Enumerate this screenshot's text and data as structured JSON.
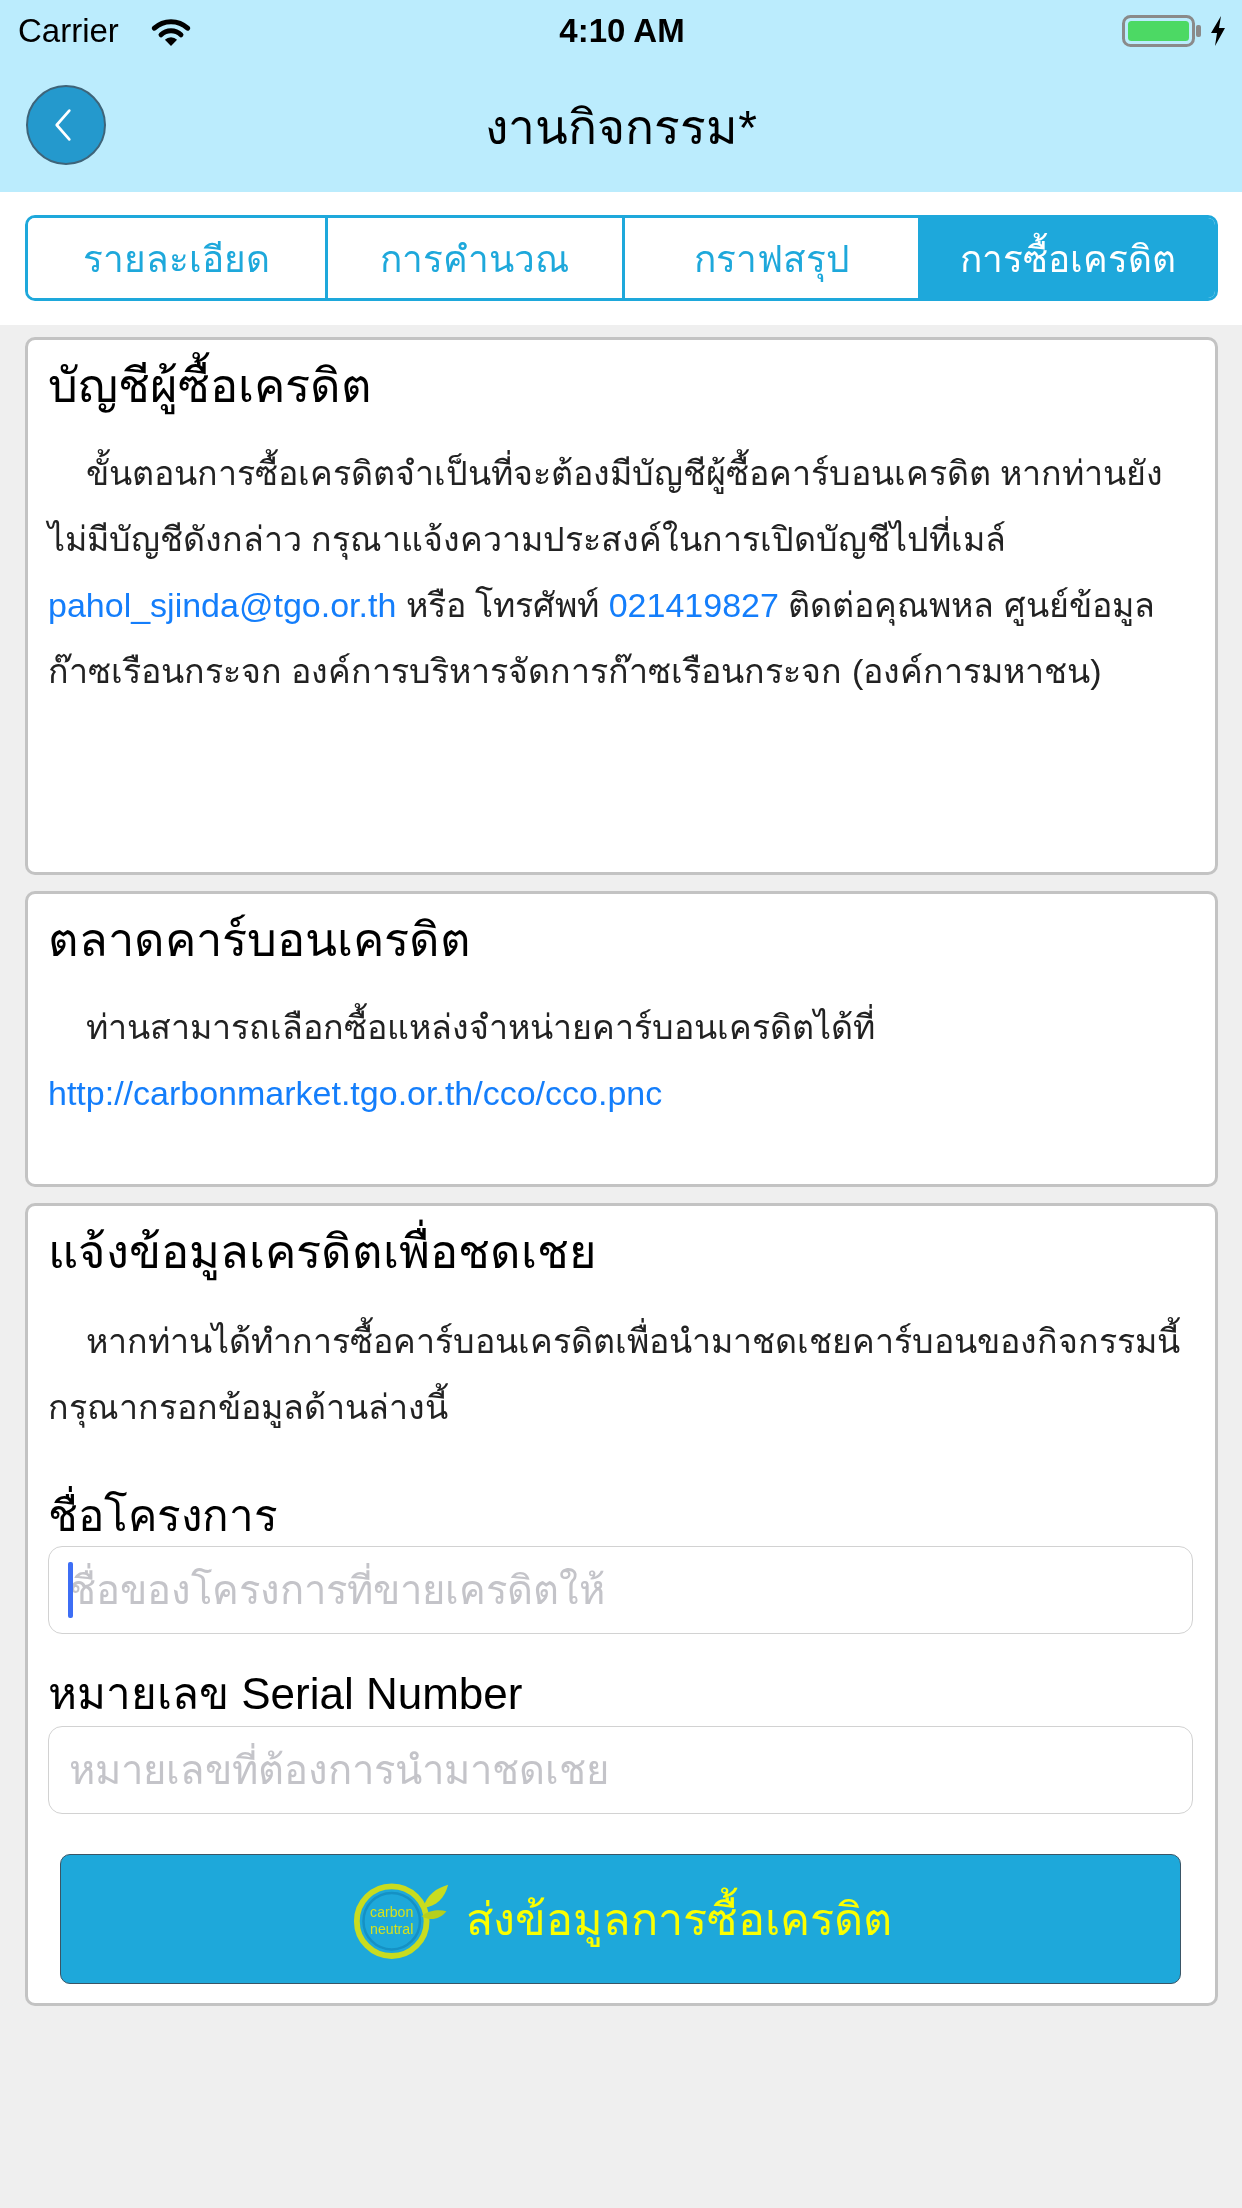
{
  "status_bar": {
    "carrier": "Carrier",
    "time": "4:10 AM"
  },
  "nav_bar": {
    "title": "งานกิจกรรม*"
  },
  "tabs": [
    {
      "label": "รายละเอียด",
      "selected": false
    },
    {
      "label": "การคำนวณ",
      "selected": false
    },
    {
      "label": "กราฟสรุป",
      "selected": false
    },
    {
      "label": "การซื้อเครดิต",
      "selected": true
    }
  ],
  "sections": [
    {
      "title": "บัญชีผู้ซื้อเครดิต",
      "paragraph": [
        {
          "kind": "text",
          "text": "ขั้นตอนการซื้อเครดิตจำเป็นที่จะต้องมีบัญชีผู้ซื้อคาร์บอนเครดิต หากท่านยังไม่มีบัญชีดังกล่าว กรุณาแจ้งความประสงค์ในการเปิดบัญชีไปที่เมล์ "
        },
        {
          "kind": "link",
          "text": "pahol_sjinda@tgo.or.th"
        },
        {
          "kind": "text",
          "text": " หรือ โทรศัพท์ "
        },
        {
          "kind": "link",
          "text": "021419827"
        },
        {
          "kind": "text",
          "text": " ติดต่อคุณพหล ศูนย์ข้อมูลก๊าซเรือนกระจก องค์การบริหารจัดการก๊าซเรือนกระจก (องค์การมหาชน)"
        }
      ]
    },
    {
      "title": "ตลาดคาร์บอนเครดิต",
      "paragraph": [
        {
          "kind": "text",
          "text": "ท่านสามารถเลือกซื้อแหล่งจำหน่ายคาร์บอนเครดิตได้ที่ "
        },
        {
          "kind": "link",
          "text": "http://carbonmarket.tgo.or.th/cco/cco.pnc"
        }
      ]
    },
    {
      "title": "แจ้งข้อมูลเครดิตเพื่อชดเชย",
      "paragraph": [
        {
          "kind": "text",
          "text": "หากท่านได้ทำการซื้อคาร์บอนเครดิตเพื่อนำมาชดเชยคาร์บอนของกิจกรรมนี้กรุณากรอกข้อมูลด้านล่างนี้"
        }
      ],
      "fields": [
        {
          "label": "ชื่อโครงการ",
          "placeholder": "ชื่อของโครงการที่ขายเครดิตให้",
          "focused": true
        },
        {
          "label": "หมายเลข Serial Number",
          "placeholder": "หมายเลขที่ต้องการนำมาชดเชย",
          "focused": false
        }
      ],
      "button": {
        "label": "ส่งข้อมูลการซื้อเครดิต",
        "logo_text": [
          "carbon",
          "neutral"
        ]
      }
    }
  ]
}
